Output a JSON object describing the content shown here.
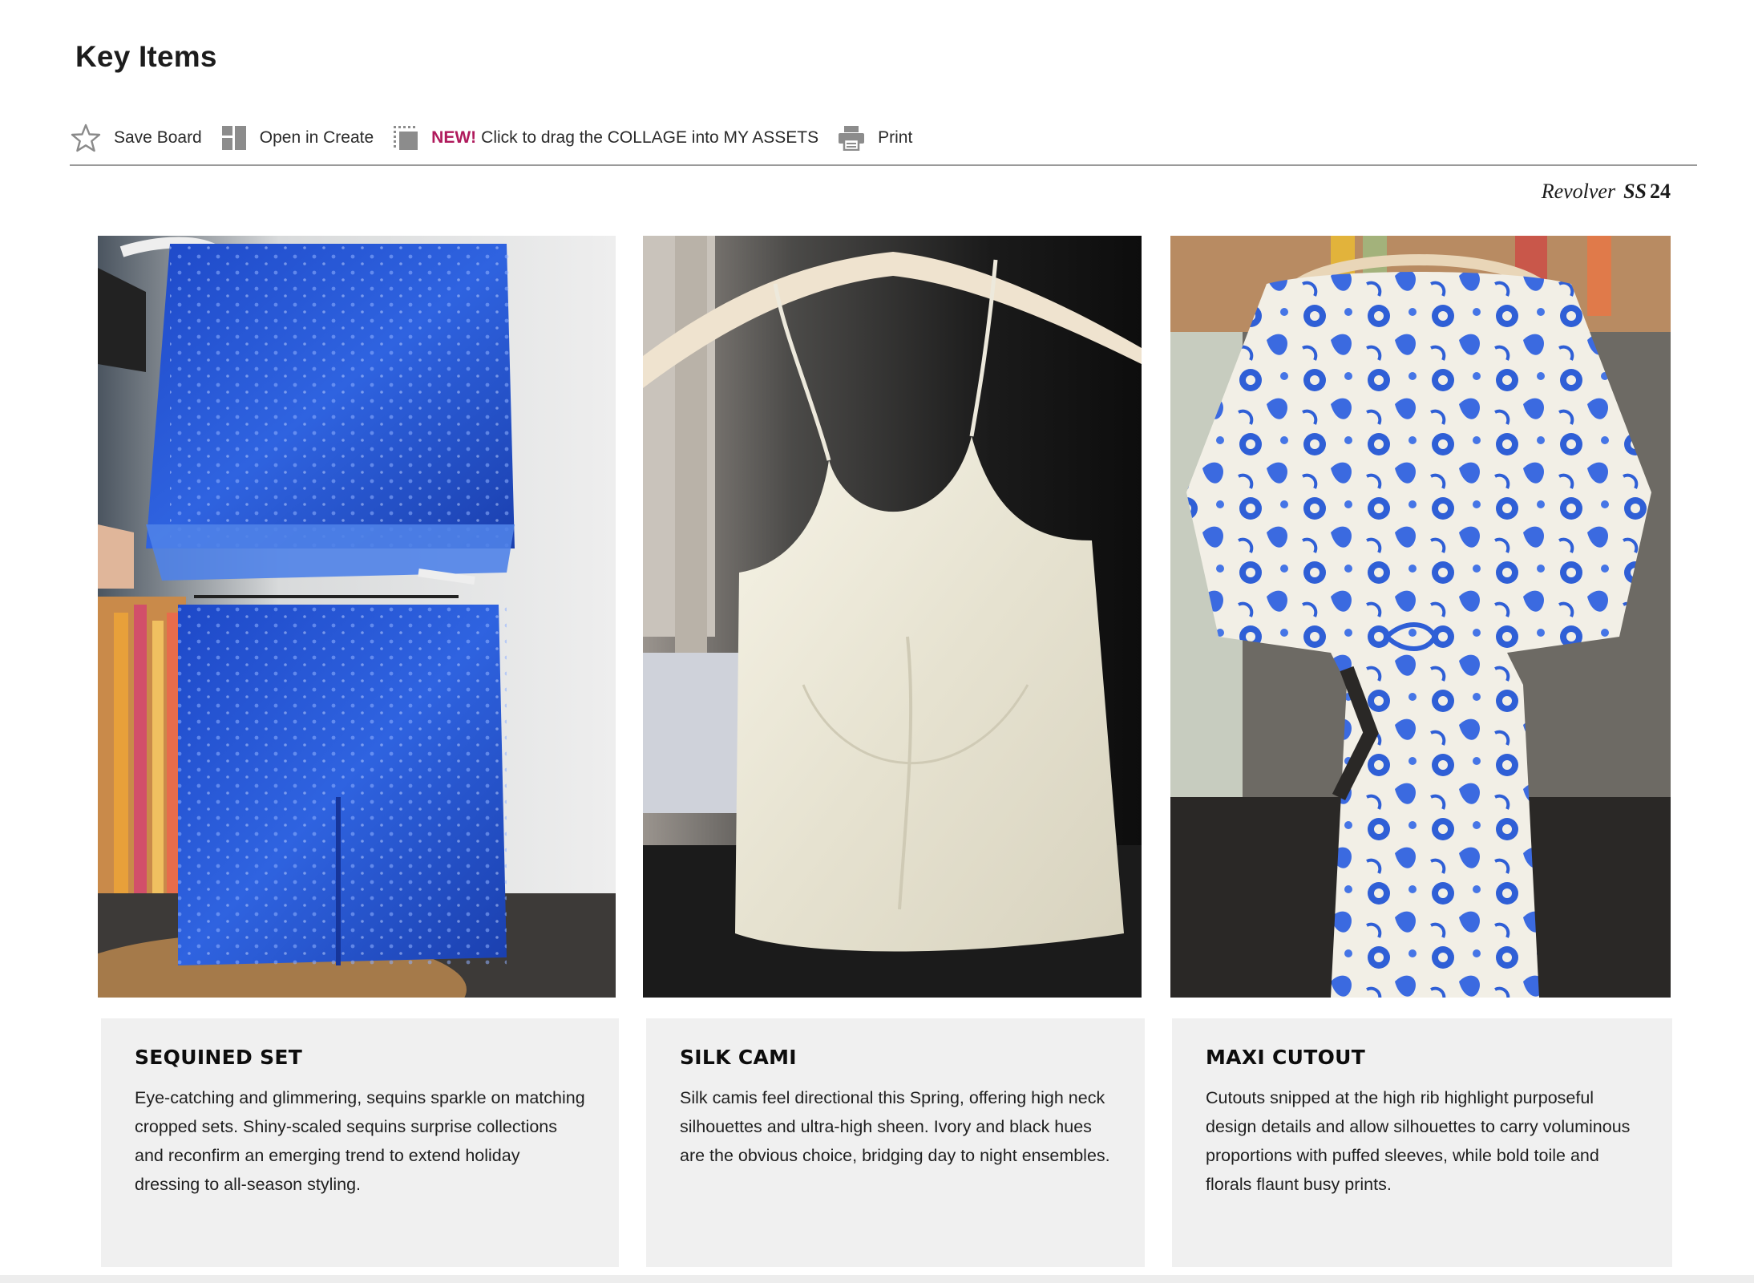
{
  "page": {
    "title": "Key Items"
  },
  "toolbar": {
    "save_board": "Save Board",
    "open_in_create": "Open in Create",
    "collage_badge": "NEW!",
    "collage_text": "Click to drag the COLLAGE into MY ASSETS",
    "print": "Print"
  },
  "brand": {
    "name": "Revolver",
    "season": "SS",
    "year": "24"
  },
  "items": [
    {
      "title": "SEQUINED SET",
      "description": "Eye-catching and glimmering, sequins sparkle on matching cropped sets. Shiny-scaled sequins surprise collections and reconfirm an emerging trend to extend holiday dressing to all-season styling."
    },
    {
      "title": "SILK CAMI",
      "description": "Silk camis feel directional this Spring, offering high neck silhouettes and ultra-high sheen. Ivory and black hues are the obvious choice, bridging day to night ensembles."
    },
    {
      "title": "MAXI CUTOUT",
      "description": "Cutouts snipped at the high rib highlight purposeful design details and allow silhouettes to carry voluminous proportions with puffed sleeves, while bold toile and florals flaunt busy prints."
    }
  ],
  "colors": {
    "accent_new": "#b01a5c",
    "card_background": "#f0f0f0",
    "divider": "#9a9a9a"
  },
  "icons": {
    "save": "star-icon",
    "create": "layout-icon",
    "collage": "collage-icon",
    "print": "printer-icon"
  }
}
